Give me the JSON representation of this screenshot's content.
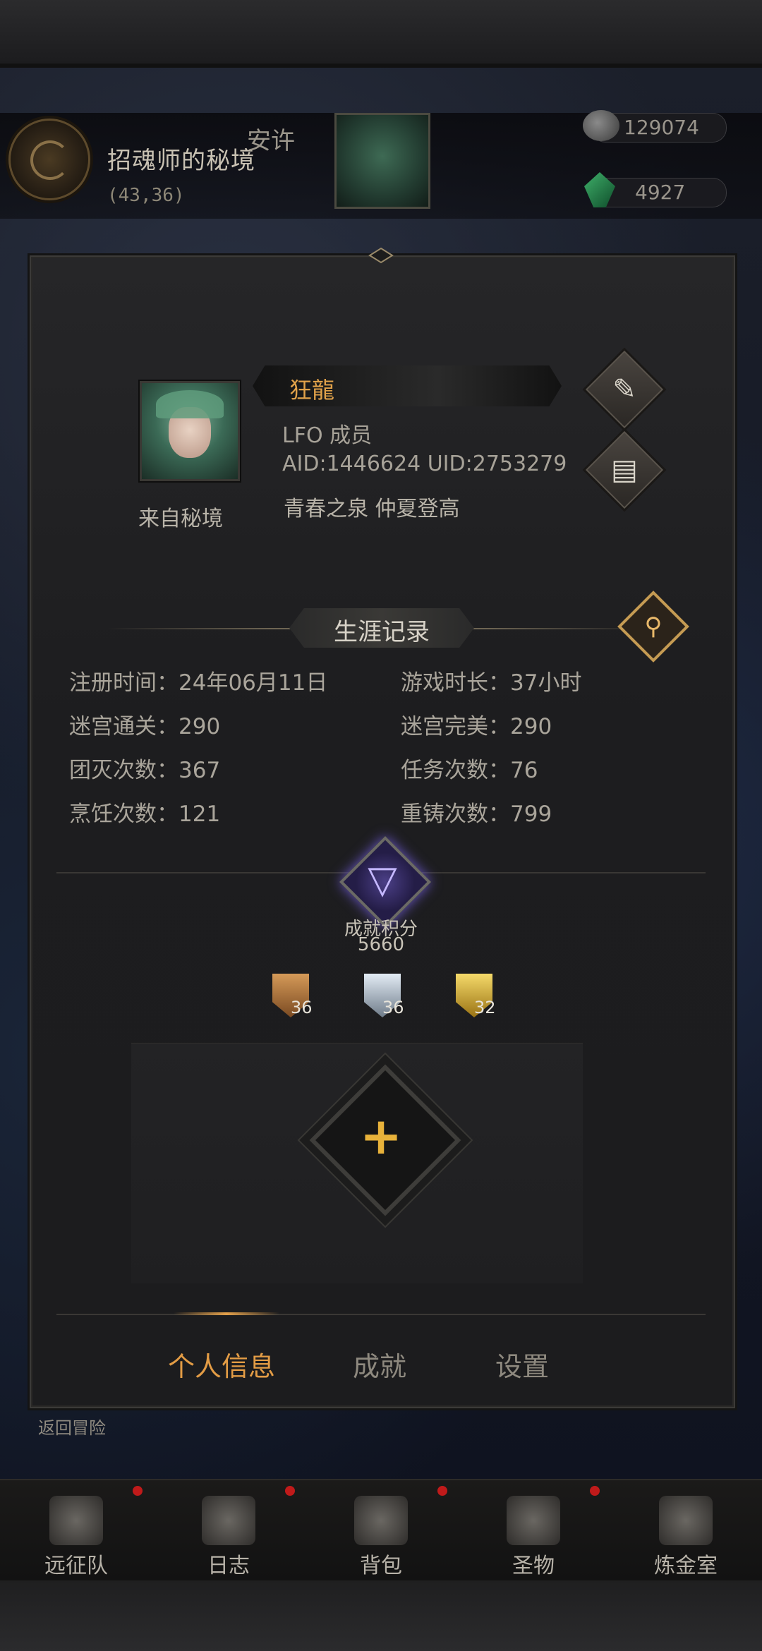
{
  "hud": {
    "location_title": "招魂师的秘境",
    "location_coords": "(43,36)",
    "player_name_partial": "安许",
    "currency_silver": "129074",
    "currency_gem": "4927"
  },
  "profile": {
    "name": "狂龍",
    "guild": "LFO 成员",
    "ids": "AID:1446624 UID:2753279",
    "tags": "青春之泉 仲夏登高",
    "from_label": "来自秘境"
  },
  "career": {
    "section_title": "生涯记录",
    "stats": [
      {
        "label": "注册时间：",
        "value": "24年06月11日"
      },
      {
        "label": "游戏时长：",
        "value": "37小时"
      },
      {
        "label": "迷宫通关：",
        "value": "290"
      },
      {
        "label": "迷宫完美：",
        "value": "290"
      },
      {
        "label": "团灭次数：",
        "value": "367"
      },
      {
        "label": "任务次数：",
        "value": "76"
      },
      {
        "label": "烹饪次数：",
        "value": "121"
      },
      {
        "label": "重铸次数：",
        "value": "799"
      }
    ]
  },
  "achievement": {
    "label": "成就积分",
    "score": "5660",
    "medals": [
      {
        "tier": "bronze",
        "count": "36",
        "color": "#b7793e"
      },
      {
        "tier": "silver",
        "count": "36",
        "color": "#b8c3cf"
      },
      {
        "tier": "gold",
        "count": "32",
        "color": "#e3b73a"
      }
    ]
  },
  "tabs": [
    {
      "label": "个人信息",
      "active": true
    },
    {
      "label": "成就",
      "active": false
    },
    {
      "label": "设置",
      "active": false
    }
  ],
  "return_label": "返回冒险",
  "bottom_nav": [
    {
      "label": "远征队",
      "icon": "horned-helmet-icon"
    },
    {
      "label": "日志",
      "icon": "scroll-icon"
    },
    {
      "label": "背包",
      "icon": "bag-icon"
    },
    {
      "label": "圣物",
      "icon": "chalice-icon"
    },
    {
      "label": "炼金室",
      "icon": "alchemy-icon"
    }
  ],
  "colors": {
    "accent_orange": "#e39c45",
    "panel_bg": "#1d1d1f"
  }
}
